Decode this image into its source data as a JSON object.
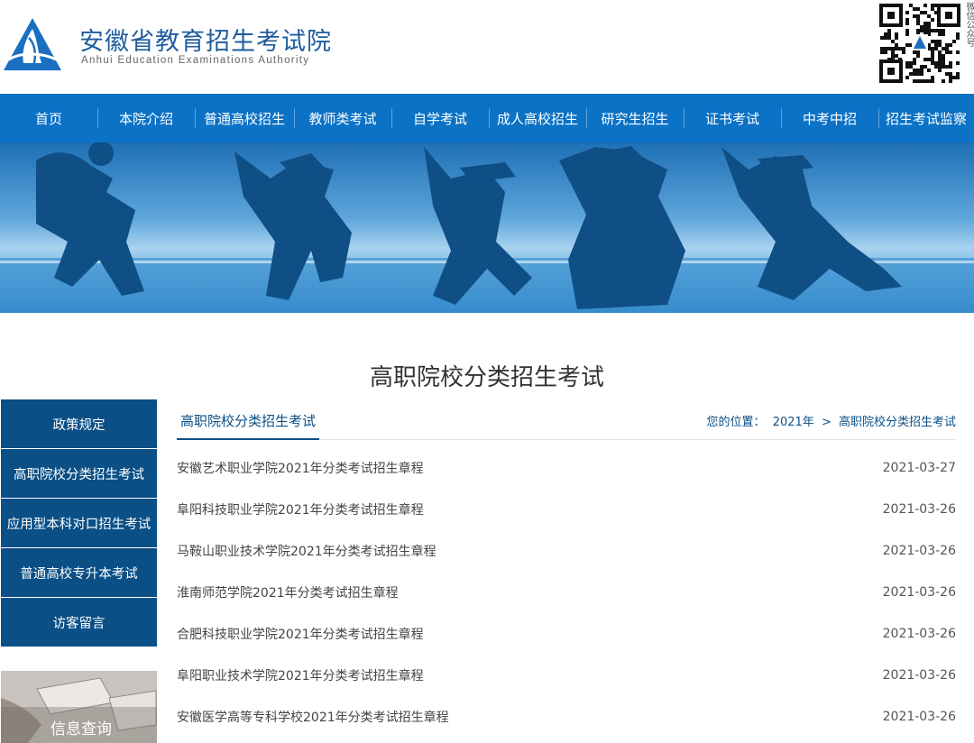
{
  "header": {
    "title_cn": "安徽省教育招生考试院",
    "title_en": "Anhui Education Examinations Authority",
    "qr_label": "微信公众号"
  },
  "nav": [
    "首页",
    "本院介绍",
    "普通高校招生",
    "教师类考试",
    "自学考试",
    "成人高校招生",
    "研究生招生",
    "证书考试",
    "中考中招",
    "招生考试监察"
  ],
  "page_title": "高职院校分类招生考试",
  "sidebar": {
    "items": [
      "政策规定",
      "高职院校分类招生考试",
      "应用型本科对口招生考试",
      "普通高校专升本考试",
      "访客留言"
    ],
    "info_label": "信息查询"
  },
  "content": {
    "tab": "高职院校分类招生考试",
    "crumb_prefix": "您的位置：",
    "crumb_year": "2021年",
    "crumb_sep": ">",
    "crumb_current": "高职院校分类招生考试",
    "rows": [
      {
        "title": "安徽艺术职业学院2021年分类考试招生章程",
        "date": "2021-03-27"
      },
      {
        "title": "阜阳科技职业学院2021年分类考试招生章程",
        "date": "2021-03-26"
      },
      {
        "title": "马鞍山职业技术学院2021年分类考试招生章程",
        "date": "2021-03-26"
      },
      {
        "title": "淮南师范学院2021年分类考试招生章程",
        "date": "2021-03-26"
      },
      {
        "title": "合肥科技职业学院2021年分类考试招生章程",
        "date": "2021-03-26"
      },
      {
        "title": "阜阳职业技术学院2021年分类考试招生章程",
        "date": "2021-03-26"
      },
      {
        "title": "安徽医学高等专科学校2021年分类考试招生章程",
        "date": "2021-03-26"
      }
    ]
  },
  "colors": {
    "nav_blue": "#0b72c6",
    "sidebar_navy": "#0a4f86",
    "brand_blue": "#1f5c9e"
  }
}
